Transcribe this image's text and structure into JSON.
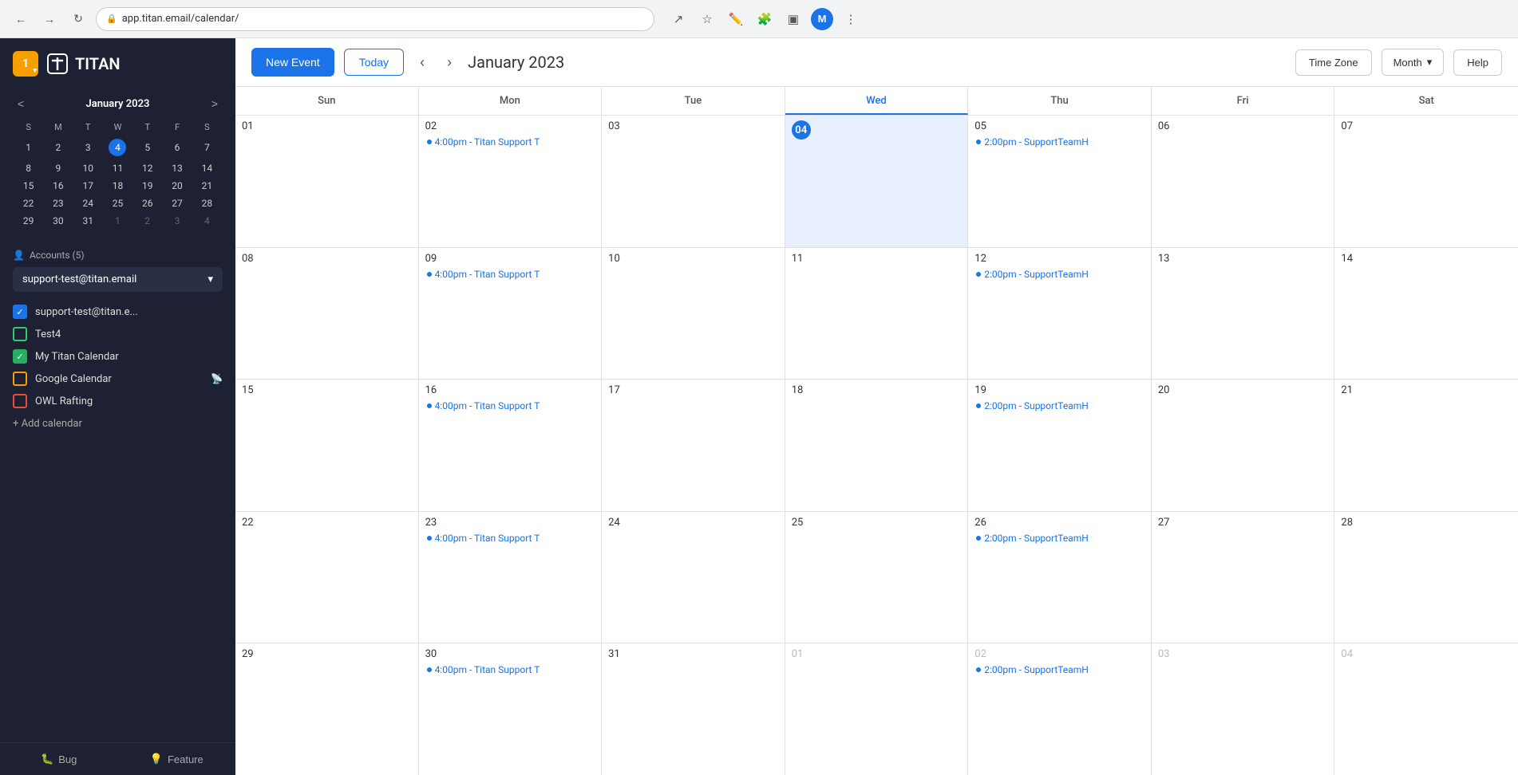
{
  "browser": {
    "url": "app.titan.email/calendar/",
    "back_title": "Back",
    "forward_title": "Forward",
    "refresh_title": "Refresh",
    "avatar_letter": "M"
  },
  "sidebar": {
    "notification_count": "1",
    "logo_text": "TITAN",
    "mini_calendar": {
      "title": "January 2023",
      "prev_label": "<",
      "next_label": ">",
      "day_headers": [
        "S",
        "M",
        "T",
        "W",
        "T",
        "F",
        "S"
      ],
      "weeks": [
        [
          {
            "day": "1",
            "month": "current"
          },
          {
            "day": "2",
            "month": "current"
          },
          {
            "day": "3",
            "month": "current"
          },
          {
            "day": "4",
            "month": "current",
            "today": true
          },
          {
            "day": "5",
            "month": "current"
          },
          {
            "day": "6",
            "month": "current"
          },
          {
            "day": "7",
            "month": "current"
          }
        ],
        [
          {
            "day": "8",
            "month": "current"
          },
          {
            "day": "9",
            "month": "current"
          },
          {
            "day": "10",
            "month": "current"
          },
          {
            "day": "11",
            "month": "current"
          },
          {
            "day": "12",
            "month": "current"
          },
          {
            "day": "13",
            "month": "current"
          },
          {
            "day": "14",
            "month": "current"
          }
        ],
        [
          {
            "day": "15",
            "month": "current"
          },
          {
            "day": "16",
            "month": "current"
          },
          {
            "day": "17",
            "month": "current"
          },
          {
            "day": "18",
            "month": "current"
          },
          {
            "day": "19",
            "month": "current"
          },
          {
            "day": "20",
            "month": "current"
          },
          {
            "day": "21",
            "month": "current"
          }
        ],
        [
          {
            "day": "22",
            "month": "current"
          },
          {
            "day": "23",
            "month": "current"
          },
          {
            "day": "24",
            "month": "current"
          },
          {
            "day": "25",
            "month": "current"
          },
          {
            "day": "26",
            "month": "current"
          },
          {
            "day": "27",
            "month": "current"
          },
          {
            "day": "28",
            "month": "current"
          }
        ],
        [
          {
            "day": "29",
            "month": "current"
          },
          {
            "day": "30",
            "month": "current"
          },
          {
            "day": "31",
            "month": "current"
          },
          {
            "day": "1",
            "month": "other"
          },
          {
            "day": "2",
            "month": "other"
          },
          {
            "day": "3",
            "month": "other"
          },
          {
            "day": "4",
            "month": "other"
          }
        ]
      ]
    },
    "accounts_label": "Accounts (5)",
    "selected_account": "support-test@titan.email",
    "calendars": [
      {
        "name": "support-test@titan.e...",
        "color": "#1a73e8",
        "checked": true,
        "type": "check"
      },
      {
        "name": "Test4",
        "color": "#2ecc71",
        "checked": false,
        "type": "square"
      },
      {
        "name": "My Titan Calendar",
        "color": "#27ae60",
        "checked": true,
        "type": "check"
      },
      {
        "name": "Google Calendar",
        "color": "#f59f00",
        "checked": false,
        "type": "square"
      },
      {
        "name": "OWL Rafting",
        "color": "#e74c3c",
        "checked": false,
        "type": "square"
      }
    ],
    "add_calendar_label": "+ Add calendar",
    "bottom_btns": [
      {
        "label": "Bug",
        "icon": "🐛"
      },
      {
        "label": "Feature",
        "icon": "💡"
      }
    ]
  },
  "toolbar": {
    "new_event_label": "New Event",
    "today_label": "Today",
    "prev_label": "‹",
    "next_label": "›",
    "month_title": "January 2023",
    "timezone_label": "Time Zone",
    "month_view_label": "Month",
    "help_label": "Help"
  },
  "calendar": {
    "day_headers": [
      {
        "label": "Sun",
        "today": false
      },
      {
        "label": "Mon",
        "today": false
      },
      {
        "label": "Tue",
        "today": false
      },
      {
        "label": "Wed",
        "today": true
      },
      {
        "label": "Thu",
        "today": false
      },
      {
        "label": "Fri",
        "today": false
      },
      {
        "label": "Sat",
        "today": false
      }
    ],
    "weeks": [
      {
        "cells": [
          {
            "day": "01",
            "month": "current",
            "today": false,
            "events": []
          },
          {
            "day": "02",
            "month": "current",
            "today": false,
            "events": [
              {
                "time": "4:00pm",
                "title": "Titan Support T"
              }
            ]
          },
          {
            "day": "03",
            "month": "current",
            "today": false,
            "events": []
          },
          {
            "day": "04",
            "month": "current",
            "today": true,
            "events": []
          },
          {
            "day": "05",
            "month": "current",
            "today": false,
            "events": [
              {
                "time": "2:00pm",
                "title": "SupportTeamH"
              }
            ]
          },
          {
            "day": "06",
            "month": "current",
            "today": false,
            "events": []
          },
          {
            "day": "07",
            "month": "current",
            "today": false,
            "events": []
          }
        ]
      },
      {
        "cells": [
          {
            "day": "08",
            "month": "current",
            "today": false,
            "events": []
          },
          {
            "day": "09",
            "month": "current",
            "today": false,
            "events": [
              {
                "time": "4:00pm",
                "title": "Titan Support T"
              }
            ]
          },
          {
            "day": "10",
            "month": "current",
            "today": false,
            "events": []
          },
          {
            "day": "11",
            "month": "current",
            "today": false,
            "events": []
          },
          {
            "day": "12",
            "month": "current",
            "today": false,
            "events": [
              {
                "time": "2:00pm",
                "title": "SupportTeamH"
              }
            ]
          },
          {
            "day": "13",
            "month": "current",
            "today": false,
            "events": []
          },
          {
            "day": "14",
            "month": "current",
            "today": false,
            "events": []
          }
        ]
      },
      {
        "cells": [
          {
            "day": "15",
            "month": "current",
            "today": false,
            "events": []
          },
          {
            "day": "16",
            "month": "current",
            "today": false,
            "events": [
              {
                "time": "4:00pm",
                "title": "Titan Support T"
              }
            ]
          },
          {
            "day": "17",
            "month": "current",
            "today": false,
            "events": []
          },
          {
            "day": "18",
            "month": "current",
            "today": false,
            "events": []
          },
          {
            "day": "19",
            "month": "current",
            "today": false,
            "events": [
              {
                "time": "2:00pm",
                "title": "SupportTeamH"
              }
            ]
          },
          {
            "day": "20",
            "month": "current",
            "today": false,
            "events": []
          },
          {
            "day": "21",
            "month": "current",
            "today": false,
            "events": []
          }
        ]
      },
      {
        "cells": [
          {
            "day": "22",
            "month": "current",
            "today": false,
            "events": []
          },
          {
            "day": "23",
            "month": "current",
            "today": false,
            "events": [
              {
                "time": "4:00pm",
                "title": "Titan Support T"
              }
            ]
          },
          {
            "day": "24",
            "month": "current",
            "today": false,
            "events": []
          },
          {
            "day": "25",
            "month": "current",
            "today": false,
            "events": []
          },
          {
            "day": "26",
            "month": "current",
            "today": false,
            "events": [
              {
                "time": "2:00pm",
                "title": "SupportTeamH"
              }
            ]
          },
          {
            "day": "27",
            "month": "current",
            "today": false,
            "events": []
          },
          {
            "day": "28",
            "month": "current",
            "today": false,
            "events": []
          }
        ]
      },
      {
        "cells": [
          {
            "day": "29",
            "month": "current",
            "today": false,
            "events": []
          },
          {
            "day": "30",
            "month": "current",
            "today": false,
            "events": [
              {
                "time": "4:00pm",
                "title": "Titan Support T"
              }
            ]
          },
          {
            "day": "31",
            "month": "current",
            "today": false,
            "events": []
          },
          {
            "day": "01",
            "month": "other",
            "today": false,
            "events": []
          },
          {
            "day": "02",
            "month": "other",
            "today": false,
            "events": [
              {
                "time": "2:00pm",
                "title": "SupportTeamH"
              }
            ]
          },
          {
            "day": "03",
            "month": "other",
            "today": false,
            "events": []
          },
          {
            "day": "04",
            "month": "other",
            "today": false,
            "events": []
          }
        ]
      }
    ]
  }
}
